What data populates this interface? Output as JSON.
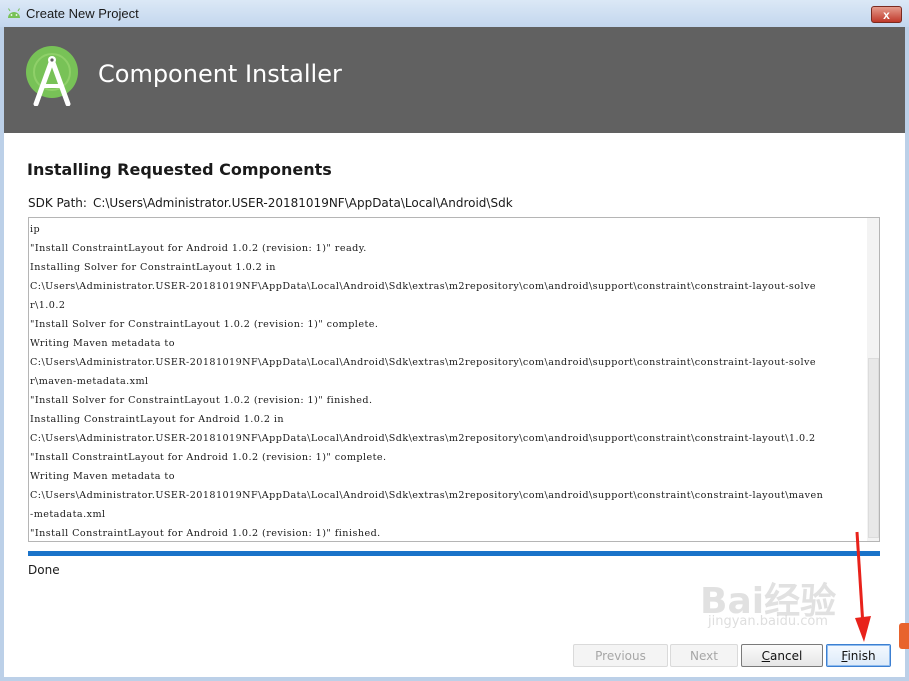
{
  "window": {
    "title": "Create New Project",
    "close_glyph": "x"
  },
  "banner": {
    "title": "Component Installer",
    "icon": "android-studio-logo-icon"
  },
  "content": {
    "heading": "Installing Requested Components",
    "sdk_label": "SDK Path:",
    "sdk_path": "C:\\Users\\Administrator.USER-20181019NF\\AppData\\Local\\Android\\Sdk",
    "log_lines": [
      "ip",
      "\"Install ConstraintLayout for Android 1.0.2 (revision: 1)\" ready.",
      "Installing Solver for ConstraintLayout 1.0.2 in",
      "C:\\Users\\Administrator.USER-20181019NF\\AppData\\Local\\Android\\Sdk\\extras\\m2repository\\com\\android\\support\\constraint\\constraint-layout-solve",
      "r\\1.0.2",
      "\"Install Solver for ConstraintLayout 1.0.2 (revision: 1)\" complete.",
      "Writing Maven metadata to",
      "C:\\Users\\Administrator.USER-20181019NF\\AppData\\Local\\Android\\Sdk\\extras\\m2repository\\com\\android\\support\\constraint\\constraint-layout-solve",
      "r\\maven-metadata.xml",
      "\"Install Solver for ConstraintLayout 1.0.2 (revision: 1)\" finished.",
      "Installing ConstraintLayout for Android 1.0.2 in",
      "C:\\Users\\Administrator.USER-20181019NF\\AppData\\Local\\Android\\Sdk\\extras\\m2repository\\com\\android\\support\\constraint\\constraint-layout\\1.0.2",
      "\"Install ConstraintLayout for Android 1.0.2 (revision: 1)\" complete.",
      "Writing Maven metadata to",
      "C:\\Users\\Administrator.USER-20181019NF\\AppData\\Local\\Android\\Sdk\\extras\\m2repository\\com\\android\\support\\constraint\\constraint-layout\\maven",
      "-metadata.xml",
      "\"Install ConstraintLayout for Android 1.0.2 (revision: 1)\" finished."
    ],
    "progress": 1.0,
    "status": "Done"
  },
  "footer": {
    "previous_label": "Previous",
    "next_label": "Next",
    "cancel_mnemonic": "C",
    "cancel_rest": "ancel",
    "finish_mnemonic": "F",
    "finish_rest": "inish"
  },
  "watermark": {
    "text": "Bai经验",
    "sub": "jingyan.baidu.com"
  },
  "colors": {
    "banner_bg": "#616161",
    "progress": "#1a73c9",
    "android_green": "#78c257",
    "annotation_arrow": "#e8221b"
  }
}
